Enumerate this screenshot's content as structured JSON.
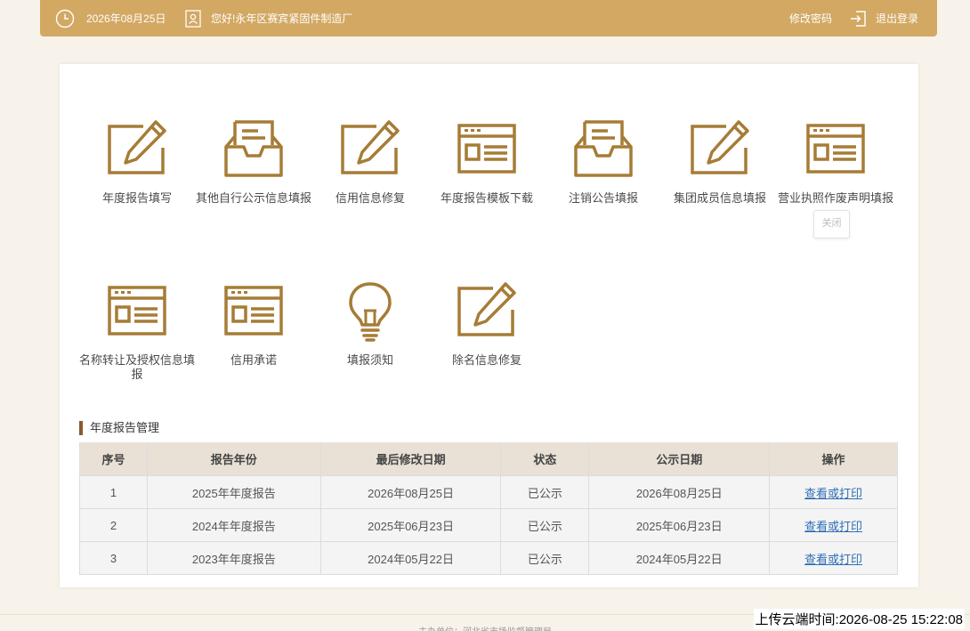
{
  "header": {
    "date": "2026年08月25日",
    "greeting": "您好!永年区赛宾紧固件制造厂",
    "change_password": "修改密码",
    "logout": "退出登录",
    "clock_icon": "clock-icon",
    "user_icon": "user-icon",
    "logout_icon": "logout-icon",
    "bg_color": "#d2a862"
  },
  "menu": [
    {
      "label": "年度报告填写",
      "icon": "edit-pen-icon"
    },
    {
      "label": "其他自行公示信息填报",
      "icon": "inbox-tray-icon"
    },
    {
      "label": "信用信息修复",
      "icon": "edit-pen-icon"
    },
    {
      "label": "年度报告模板下载",
      "icon": "browser-window-icon"
    },
    {
      "label": "注销公告填报",
      "icon": "inbox-tray-icon"
    },
    {
      "label": "集团成员信息填报",
      "icon": "edit-pen-icon"
    },
    {
      "label": "营业执照作废声明填报",
      "icon": "browser-window-icon"
    },
    {
      "label": "名称转让及授权信息填报",
      "icon": "browser-window-icon"
    },
    {
      "label": "信用承诺",
      "icon": "browser-window-icon"
    },
    {
      "label": "填报须知",
      "icon": "lightbulb-icon"
    },
    {
      "label": "除名信息修复",
      "icon": "edit-pen-icon"
    }
  ],
  "tooltip": "关闭",
  "icon_color": "#a67c36",
  "report_section": {
    "title": "年度报告管理",
    "columns": [
      "序号",
      "报告年份",
      "最后修改日期",
      "状态",
      "公示日期",
      "操作"
    ],
    "rows": [
      [
        "1",
        "2025年年度报告",
        "2026年08月25日",
        "已公示",
        "2026年08月25日",
        "查看或打印"
      ],
      [
        "2",
        "2024年年度报告",
        "2025年06月23日",
        "已公示",
        "2025年06月23日",
        "查看或打印"
      ],
      [
        "3",
        "2023年年度报告",
        "2024年05月22日",
        "已公示",
        "2024年05月22日",
        "查看或打印"
      ]
    ]
  },
  "footer": {
    "text": "主办单位：河北省市场监督管理局"
  },
  "timestamp": "上传云端时间:2026-08-25 15:22:08"
}
